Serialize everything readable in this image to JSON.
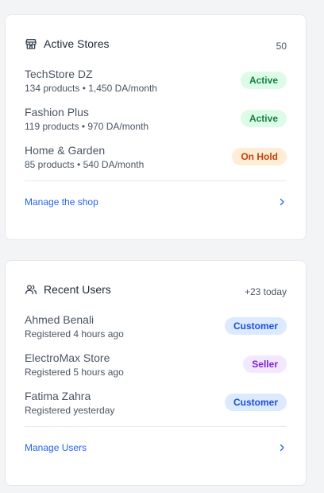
{
  "active_stores": {
    "title": "Active Stores",
    "count": "50",
    "icon": "store-icon",
    "stores": [
      {
        "name": "TechStore DZ",
        "details": "134 products • 1,450 DA/month",
        "status": "Active",
        "status_color": "#15803d"
      },
      {
        "name": "Fashion Plus",
        "details": "119 products • 970 DA/month",
        "status": "Active",
        "status_color": "#15803d"
      },
      {
        "name": "Home & Garden",
        "details": "85 products • 540 DA/month",
        "status": "On Hold",
        "status_color": "#c2410c"
      }
    ],
    "footer_link": "Manage the shop"
  },
  "recent_users": {
    "title": "Recent Users",
    "count": "+23 today",
    "icon": "users-icon",
    "users": [
      {
        "name": "Ahmed Benali",
        "registered": "Registered 4 hours ago",
        "role": "Customer",
        "role_color": "#1d4ed8"
      },
      {
        "name": "ElectroMax Store",
        "registered": "Registered 5 hours ago",
        "role": "Seller",
        "role_color": "#7e22ce"
      },
      {
        "name": "Fatima Zahra",
        "registered": "Registered yesterday",
        "role": "Customer",
        "role_color": "#1d4ed8"
      }
    ],
    "footer_link": "Manage Users"
  },
  "colors": {
    "link": "#2563eb",
    "active_bg": "#dcfce7",
    "hold_bg": "#ffedd5",
    "customer_bg": "#dbeafe",
    "seller_bg": "#f3e8ff"
  }
}
